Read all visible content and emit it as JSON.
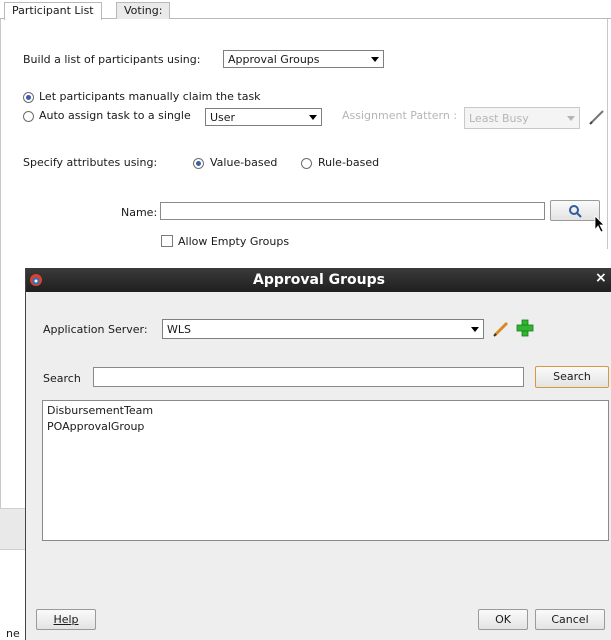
{
  "tabs": [
    {
      "label": "Participant List"
    },
    {
      "label": "Voting:"
    }
  ],
  "build": {
    "label": "Build a list of participants using:",
    "value": "Approval Groups"
  },
  "claim": {
    "manual_label": "Let participants manually claim the task",
    "auto_label": "Auto assign task to a single",
    "auto_value": "User",
    "pattern_label": "Assignment Pattern :",
    "pattern_value": "Least Busy"
  },
  "attributes": {
    "label": "Specify attributes using:",
    "value_based": "Value-based",
    "rule_based": "Rule-based"
  },
  "name_field": {
    "label": "Name:",
    "value": "",
    "allow_empty_label": "Allow Empty Groups"
  },
  "dialog": {
    "title": "Approval Groups",
    "app_server_label": "Application Server:",
    "app_server_value": "WLS",
    "search_label": "Search",
    "search_value": "",
    "search_button": "Search",
    "groups": [
      "DisbursementTeam",
      "POApprovalGroup"
    ],
    "help_button": "Help",
    "ok_button": "OK",
    "cancel_button": "Cancel",
    "close_glyph": "×"
  },
  "left_fragment": "ne",
  "colors": {
    "accent": "#3d5fa8",
    "title_bar": "#2b2b2b",
    "add_icon": "#2fb52f",
    "edit_icon": "#d9891f"
  }
}
